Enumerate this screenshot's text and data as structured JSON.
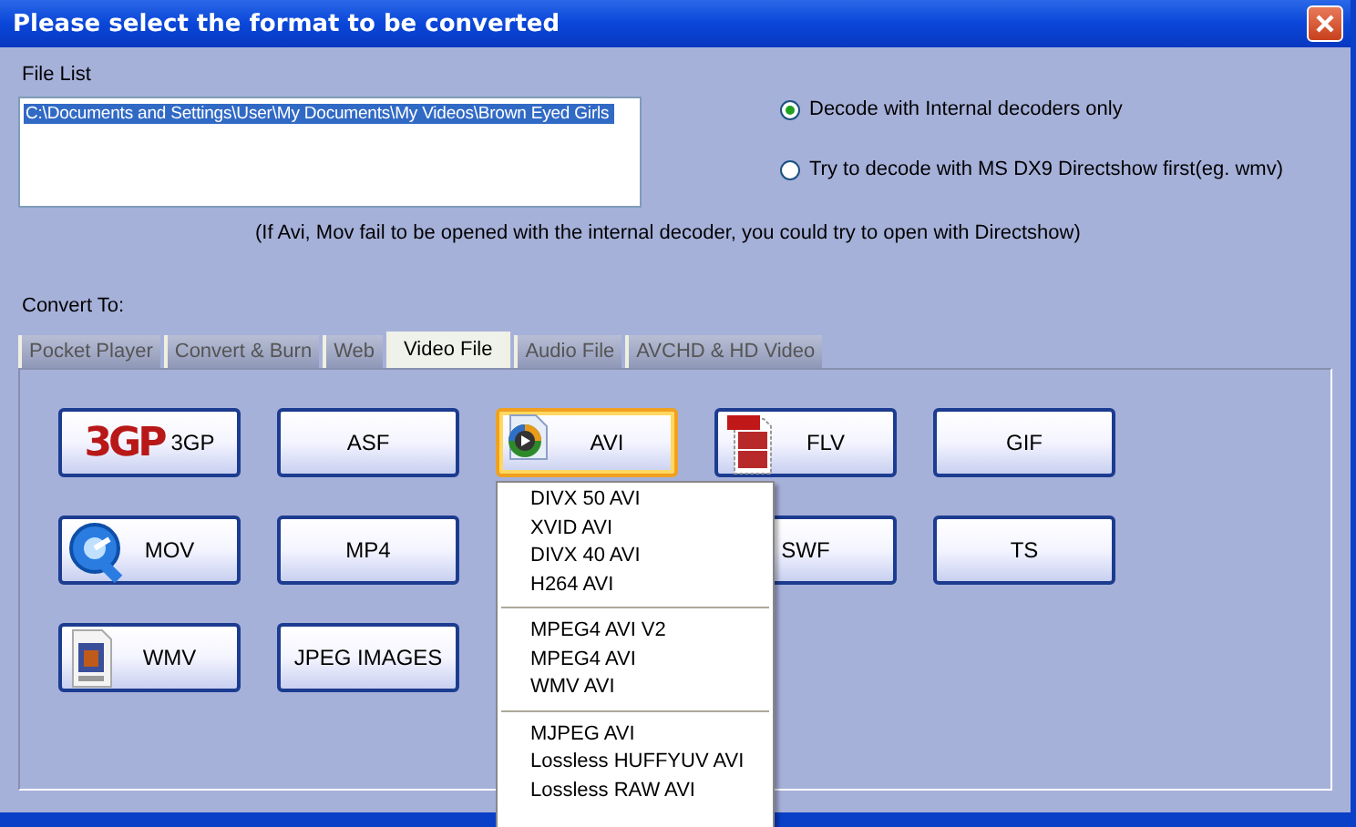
{
  "window": {
    "title": "Please select the format to be converted"
  },
  "file_list": {
    "label": "File List",
    "items": [
      {
        "text": "C:\\Documents and Settings\\User\\My Documents\\My Videos\\Brown Eyed Girls",
        "selected": true
      }
    ]
  },
  "decode_options": [
    {
      "label": "Decode with Internal decoders only",
      "selected": true
    },
    {
      "label": "Try to decode with MS DX9 Directshow first(eg. wmv)",
      "selected": false
    }
  ],
  "note": "(If Avi, Mov fail to be opened with the internal decoder, you could try to open with Directshow)",
  "convert_to": {
    "label": "Convert To:",
    "tabs": [
      {
        "label": "Pocket  Player",
        "selected": false
      },
      {
        "label": "Convert & Burn",
        "selected": false
      },
      {
        "label": "Web",
        "selected": false
      },
      {
        "label": "Video  File",
        "selected": true
      },
      {
        "label": "Audio  File",
        "selected": false
      },
      {
        "label": "AVCHD & HD Video",
        "selected": false
      }
    ]
  },
  "format_rows": [
    [
      {
        "label": "3GP",
        "kind": "logo",
        "logo_text": "3GP",
        "selected": false
      },
      {
        "label": "ASF",
        "kind": "plain",
        "selected": false
      },
      {
        "label": "AVI",
        "kind": "icon",
        "selected": true
      },
      {
        "label": "FLV",
        "kind": "icon",
        "selected": false
      },
      {
        "label": "GIF",
        "kind": "plain",
        "selected": false
      }
    ],
    [
      {
        "label": "MOV",
        "kind": "icon",
        "selected": false
      },
      {
        "label": "MP4",
        "kind": "plain",
        "selected": false
      },
      {
        "label": "SWF",
        "kind": "plain",
        "selected": false
      },
      {
        "label": "TS",
        "kind": "plain",
        "selected": false
      }
    ],
    [
      {
        "label": "WMV",
        "kind": "icon",
        "selected": false
      },
      {
        "label": "JPEG IMAGES",
        "kind": "plain",
        "selected": false
      }
    ]
  ],
  "avi_menu": [
    [
      "DIVX 50 AVI",
      "XVID AVI",
      "DIVX 40 AVI",
      "H264 AVI"
    ],
    [
      "MPEG4 AVI V2",
      "MPEG4 AVI",
      "WMV AVI"
    ],
    [
      "MJPEG AVI",
      "Lossless HUFFYUV AVI",
      "Lossless RAW AVI"
    ]
  ]
}
